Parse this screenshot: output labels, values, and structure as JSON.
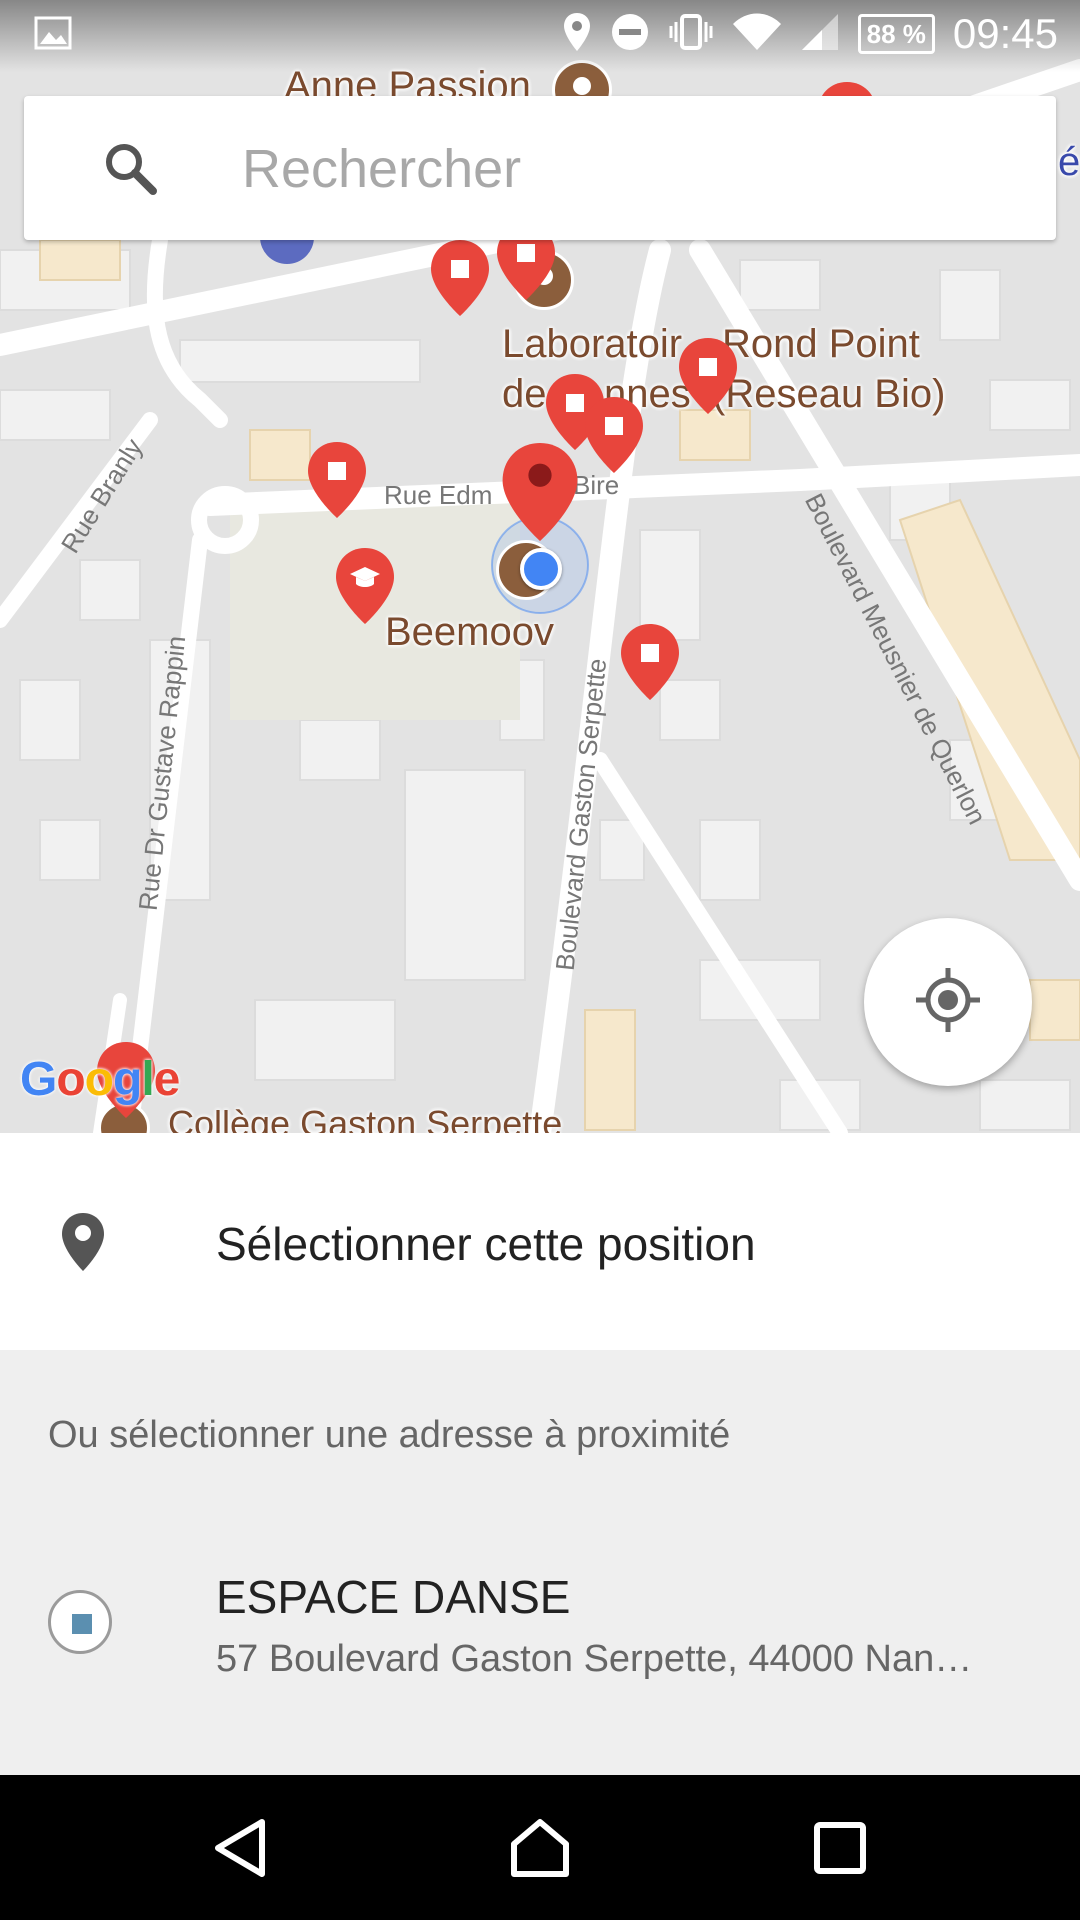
{
  "status_bar": {
    "battery": "88 %",
    "time": "09:45"
  },
  "search": {
    "placeholder": "Rechercher"
  },
  "map": {
    "streets": [
      "Rue Branly",
      "Rue Dr Gustave Rappin",
      "Boulevard Gaston Serpette",
      "Boulevard Meusnier de Querlon",
      "Rue Edm",
      "Bire"
    ],
    "pois": [
      "Anne Passion",
      "Laboratoir",
      "Rond Point",
      "de",
      "nnes",
      "(Reseau Bio)",
      "Beemoov",
      "Collège Gaston Serpette"
    ],
    "edge_text": "é",
    "logo": {
      "letters": [
        "G",
        "o",
        "o",
        "g",
        "l",
        "e"
      ],
      "colors": [
        "#4285F4",
        "#EA4335",
        "#FBBC05",
        "#4285F4",
        "#34A853",
        "#EA4335"
      ]
    }
  },
  "select_position": {
    "label": "Sélectionner cette position"
  },
  "nearby": {
    "header": "Ou sélectionner une adresse à proximité",
    "items": [
      {
        "name": "ESPACE DANSE",
        "address": "57 Boulevard Gaston Serpette, 44000 Nan…"
      }
    ]
  },
  "colors": {
    "pin_red": "#e8453c",
    "poi_brown": "#7a4a2e",
    "location_blue": "#4285f4"
  }
}
